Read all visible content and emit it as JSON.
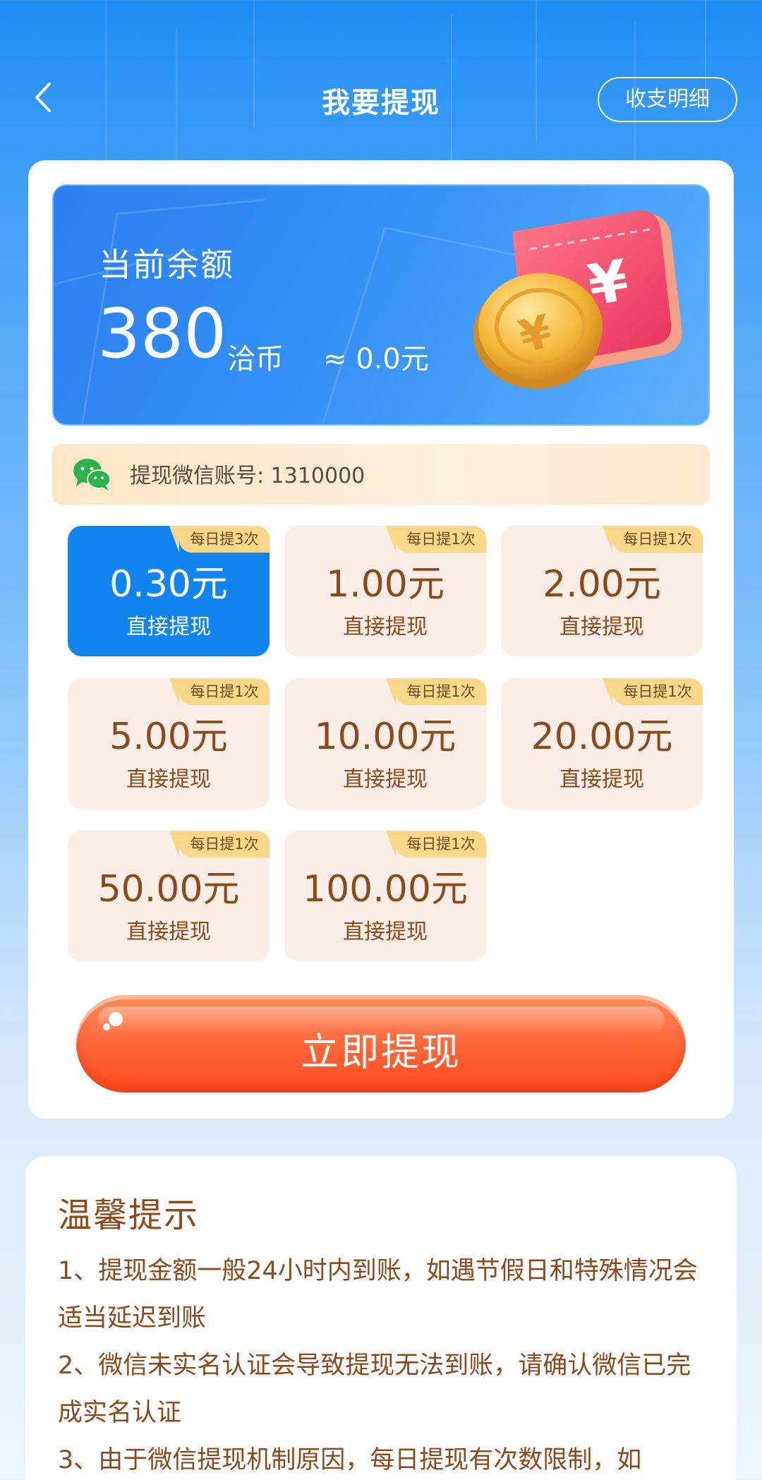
{
  "header": {
    "title": "我要提现",
    "detail_label": "收支明细"
  },
  "balance": {
    "label": "当前余额",
    "amount": "380",
    "unit": "洽币",
    "approx": "≈ 0.0元"
  },
  "wechat": {
    "text": "提现微信账号: 1310000"
  },
  "options": [
    {
      "tag": "每日提3次",
      "amount": "0.30元",
      "sub": "直接提现",
      "selected": true
    },
    {
      "tag": "每日提1次",
      "amount": "1.00元",
      "sub": "直接提现",
      "selected": false
    },
    {
      "tag": "每日提1次",
      "amount": "2.00元",
      "sub": "直接提现",
      "selected": false
    },
    {
      "tag": "每日提1次",
      "amount": "5.00元",
      "sub": "直接提现",
      "selected": false
    },
    {
      "tag": "每日提1次",
      "amount": "10.00元",
      "sub": "直接提现",
      "selected": false
    },
    {
      "tag": "每日提1次",
      "amount": "20.00元",
      "sub": "直接提现",
      "selected": false
    },
    {
      "tag": "每日提1次",
      "amount": "50.00元",
      "sub": "直接提现",
      "selected": false
    },
    {
      "tag": "每日提1次",
      "amount": "100.00元",
      "sub": "直接提现",
      "selected": false
    }
  ],
  "cta": {
    "label": "立即提现"
  },
  "tips": {
    "title": "温馨提示",
    "items": [
      "1、提现金额一般24小时内到账，如遇节假日和特殊情况会适当延迟到账",
      "2、微信未实名认证会导致提现无法到账，请确认微信已完成实名认证",
      "3、由于微信提现机制原因，每日提现有次数限制，如"
    ]
  },
  "colors": {
    "accent_blue": "#1085f0",
    "brown_text": "#8a4a1c",
    "cta_orange": "#ff5a2a",
    "tag_yellow": "#fbd889"
  },
  "icons": {
    "back": "chevron-left-icon",
    "wechat": "wechat-icon",
    "coin": "coin-illustration"
  }
}
